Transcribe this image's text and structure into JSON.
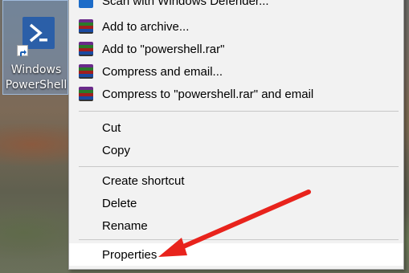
{
  "desktop": {
    "icon_label_line1": "Windows",
    "icon_label_line2": "PowerShell"
  },
  "menu": {
    "items": [
      {
        "label": "Scan with Windows Defender...",
        "icon": "defender-icon"
      },
      {
        "label": "Add to archive...",
        "icon": "winrar-icon"
      },
      {
        "label": "Add to \"powershell.rar\"",
        "icon": "winrar-icon"
      },
      {
        "label": "Compress and email...",
        "icon": "winrar-icon"
      },
      {
        "label": "Compress to \"powershell.rar\" and email",
        "icon": "winrar-icon"
      },
      {
        "label": "Cut"
      },
      {
        "label": "Copy"
      },
      {
        "label": "Create shortcut"
      },
      {
        "label": "Delete"
      },
      {
        "label": "Rename"
      },
      {
        "label": "Properties"
      }
    ]
  },
  "annotation": {
    "arrow_color": "#e8231c"
  }
}
